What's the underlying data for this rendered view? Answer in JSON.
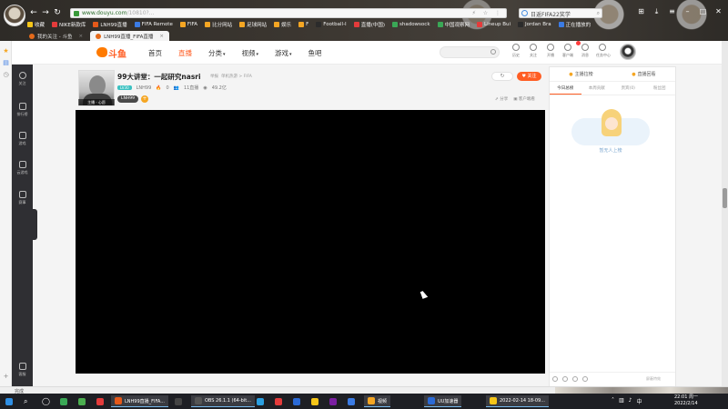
{
  "browser": {
    "address_host": "www.douyu.com",
    "address_path": "/10810?...",
    "search_text": "日返FIFA22奖学",
    "bookmarks": [
      {
        "label": "收藏",
        "color": "#f5c518"
      },
      {
        "label": "NIKE新款库",
        "color": "#e43b3b"
      },
      {
        "label": "LNH99直播",
        "color": "#e5591a"
      },
      {
        "label": "FIFA Remote",
        "color": "#3b7be4"
      },
      {
        "label": "FIFA",
        "color": "#f5a623"
      },
      {
        "label": "比分网站",
        "color": "#f5a623"
      },
      {
        "label": "足球网站",
        "color": "#f5a623"
      },
      {
        "label": "娱乐",
        "color": "#f5a623"
      },
      {
        "label": "F",
        "color": "#f5a623"
      },
      {
        "label": "Football-I",
        "color": "#2b2b2b"
      },
      {
        "label": "直播(中国)",
        "color": "#e43b3b"
      },
      {
        "label": "shadowsock",
        "color": "#3aa856"
      },
      {
        "label": "中国观察网",
        "color": "#3aa856"
      },
      {
        "label": "Lineup Bui",
        "color": "#e43b3b"
      },
      {
        "label": "Jordan Bra",
        "color": "#2b2b2b"
      },
      {
        "label": "正在播放的",
        "color": "#3b7be4"
      }
    ],
    "tabs": [
      {
        "label": "我的关注 - 斗鱼",
        "active": false
      },
      {
        "label": "LNH99直播_FIFA直播",
        "active": true
      }
    ],
    "status_text": "完成"
  },
  "site": {
    "logo_text": "斗鱼",
    "nav": [
      "首页",
      "直播",
      "分类",
      "视频",
      "游戏",
      "鱼吧"
    ],
    "header_icons": [
      "历史",
      "关注",
      "开播",
      "客户端",
      "消息",
      "任务中心"
    ],
    "sidebar": [
      "关注",
      "排行榜",
      "游戏",
      "云游戏",
      "赛事",
      "客服"
    ]
  },
  "room": {
    "title": "99大讲堂：一起研究nasri",
    "report": "举报",
    "category": "单机热游 > FIFA",
    "level": "LV30",
    "anchor_name": "LNH99",
    "hot_value": "0",
    "rank": "11直播",
    "heat": "49.2亿",
    "avatar_caption": "主播 · 心愿",
    "tag": "LNH99",
    "follow_count": "",
    "follow_label": "关注",
    "share_label": "分享",
    "client_label": "客户端看"
  },
  "right_panel": {
    "top_left": "主播拉榜",
    "top_right": "直播回看",
    "tabs": [
      "今日总榜",
      "本周贡献",
      "贵宾(0)",
      "粉丝团"
    ],
    "empty_text": "暂无人上榜",
    "shield_text": "屏蔽特效"
  },
  "taskbar": {
    "items": [
      {
        "label": "LNH99直播_FIFA...",
        "color": "#e5591a"
      },
      {
        "label": "OBS 26.1.1 (64-bit...",
        "color": "#444"
      },
      {
        "label": "视频",
        "color": "#f5a623"
      },
      {
        "label": "UU加速器",
        "color": "#2b6ad6"
      },
      {
        "label": "2022-02-14 18-09...",
        "color": "#f5c518"
      }
    ],
    "time": "22:01 周一",
    "date": "2022/2/14"
  }
}
